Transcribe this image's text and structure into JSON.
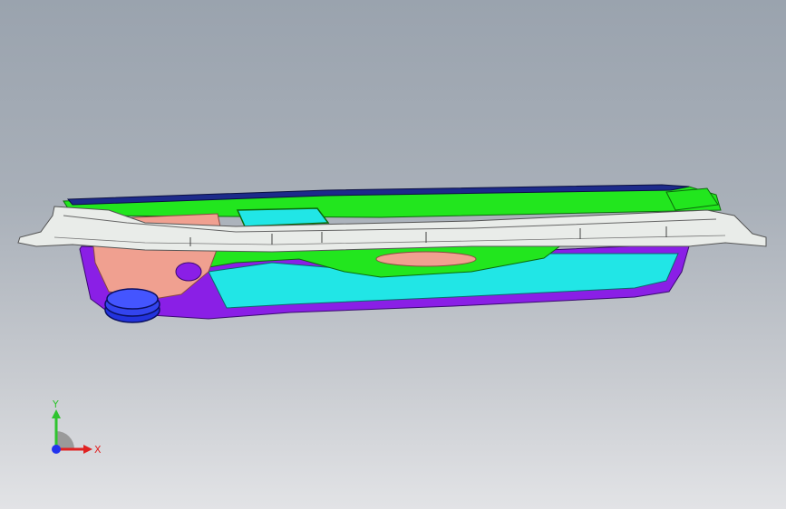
{
  "viewport": {
    "background_top": "#9aa3ae",
    "background_bottom": "#e2e3e6"
  },
  "model": {
    "part_colors": {
      "green": "#22e61e",
      "cyan": "#21e6e6",
      "purple": "#8a1fe6",
      "white": "#e9ece9",
      "salmon": "#f0a090",
      "blue": "#2233dd",
      "navy": "#1c2a8a"
    }
  },
  "triad": {
    "y_label": "Y",
    "x_label": "X",
    "y_color": "#2fc42f",
    "x_color": "#e02222",
    "z_color": "#2233ee"
  }
}
